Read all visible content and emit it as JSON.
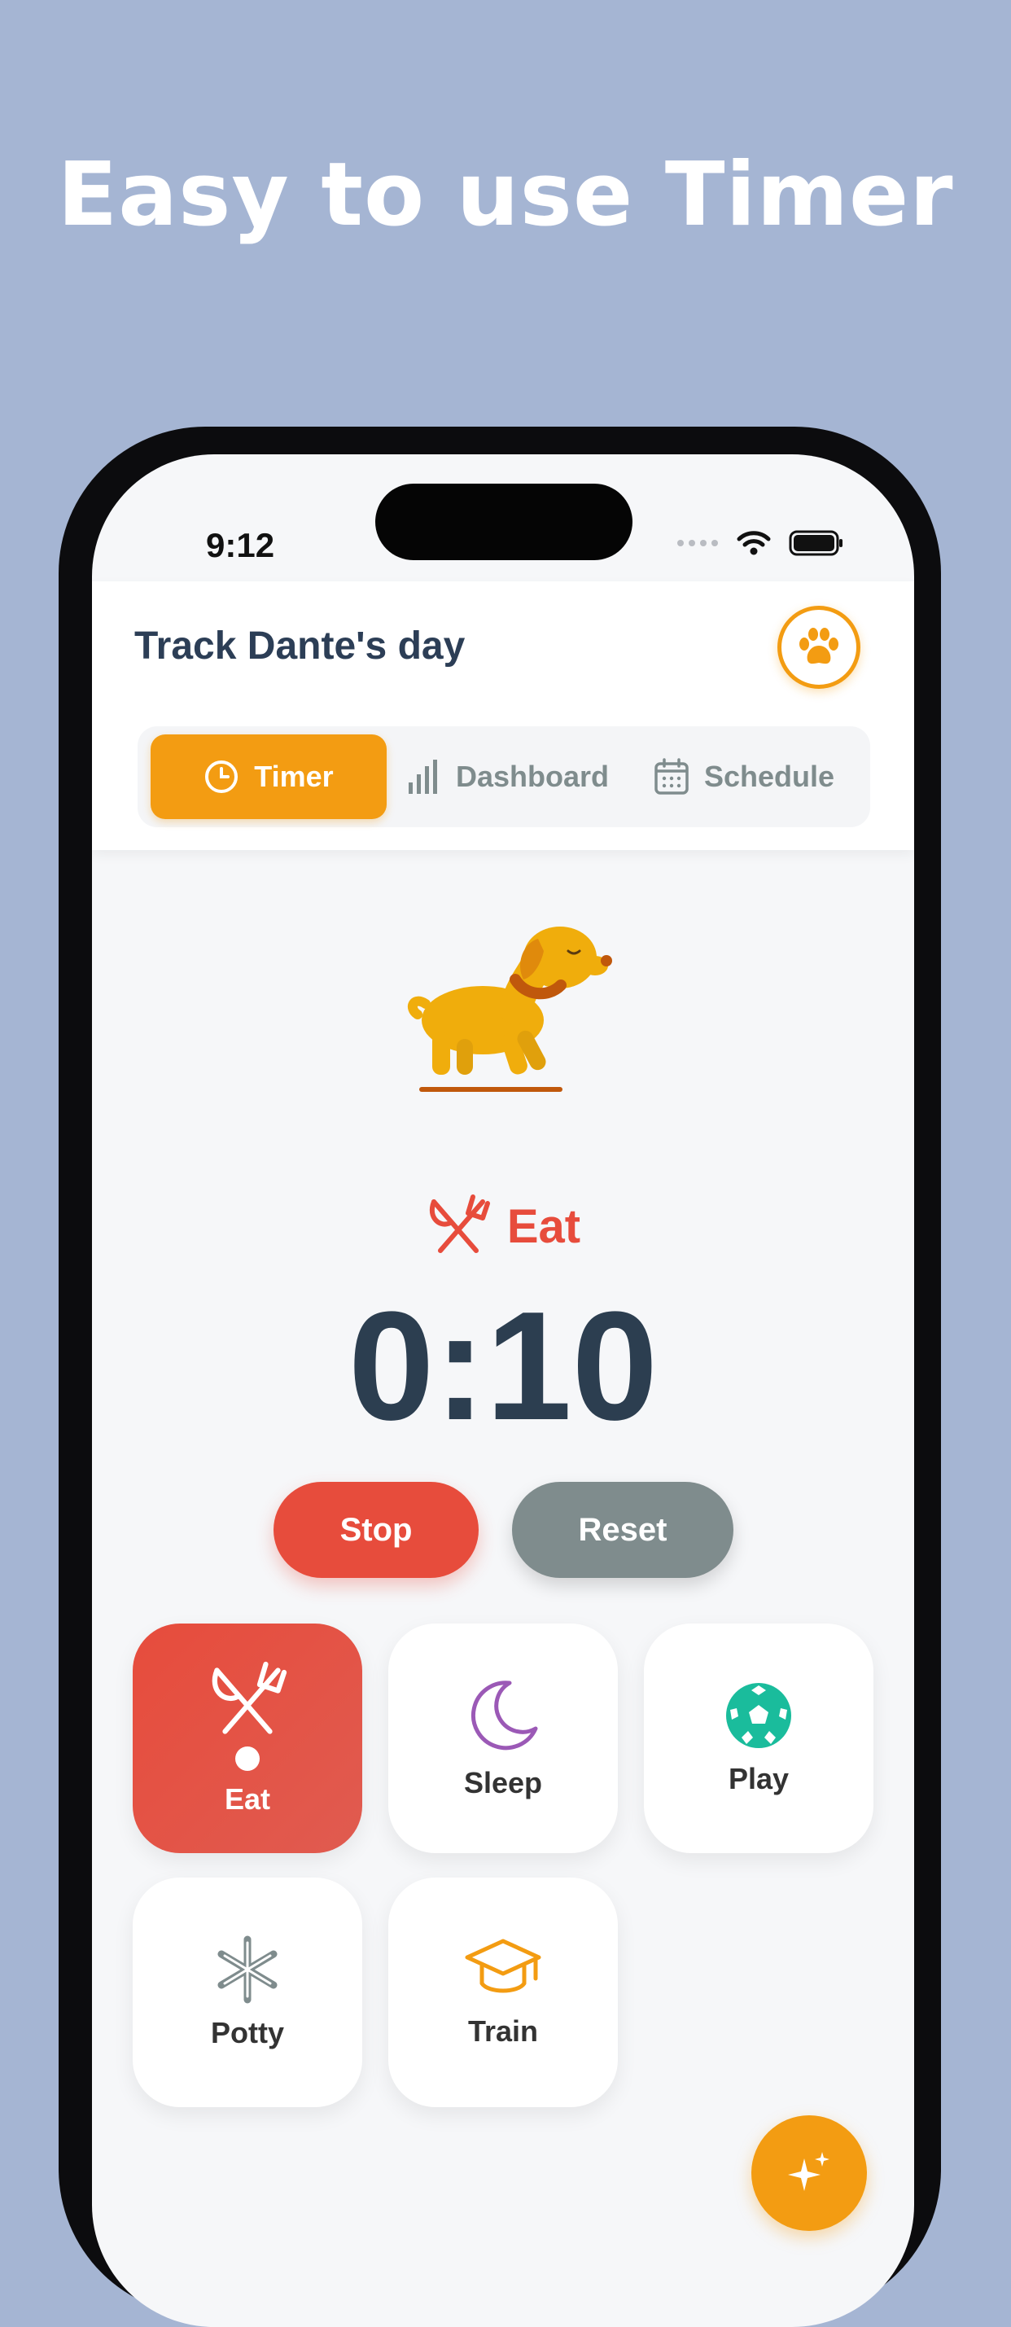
{
  "headline": "Easy to use Timer",
  "status_bar": {
    "time": "9:12"
  },
  "header": {
    "title": "Track Dante's day",
    "profile_icon": "paw-icon"
  },
  "tabs": [
    {
      "label": "Timer",
      "icon": "clock-icon",
      "active": true
    },
    {
      "label": "Dashboard",
      "icon": "bar-chart-icon",
      "active": false
    },
    {
      "label": "Schedule",
      "icon": "calendar-icon",
      "active": false
    }
  ],
  "current_activity": {
    "label": "Eat",
    "icon": "utensils-icon",
    "color": "#e74c3c"
  },
  "timer": {
    "value": "0:10"
  },
  "controls": {
    "stop_label": "Stop",
    "reset_label": "Reset"
  },
  "activities": [
    {
      "label": "Eat",
      "icon": "utensils-icon",
      "color": "#ffffff",
      "active": true
    },
    {
      "label": "Sleep",
      "icon": "moon-icon",
      "color": "#9b59b6",
      "active": false
    },
    {
      "label": "Play",
      "icon": "soccer-ball-icon",
      "color": "#1abc9c",
      "active": false
    },
    {
      "label": "Potty",
      "icon": "asterisk-icon",
      "color": "#7f8c8d",
      "active": false
    },
    {
      "label": "Train",
      "icon": "graduation-cap-icon",
      "color": "#f39c12",
      "active": false
    }
  ],
  "fab_icon": "sparkles-icon",
  "colors": {
    "accent": "#f39c12",
    "danger": "#e74c3c",
    "neutral": "#7f8c8d",
    "background": "#a5b5d3"
  }
}
